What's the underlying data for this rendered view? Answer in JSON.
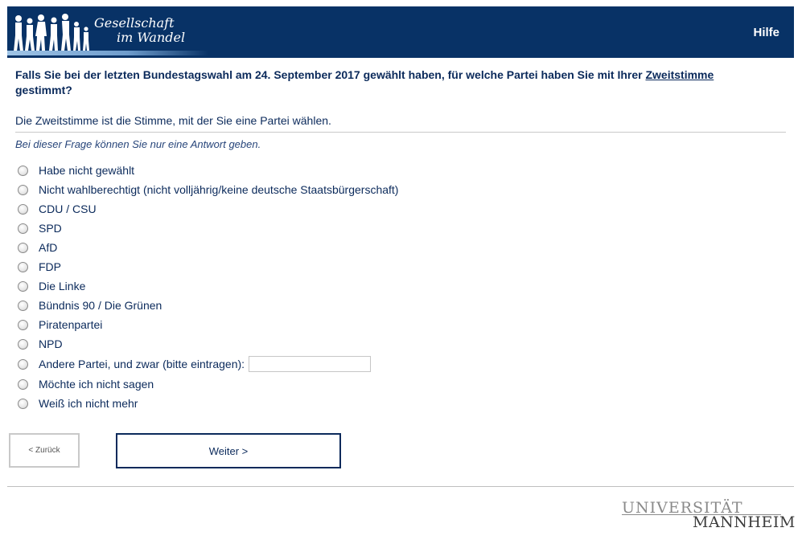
{
  "header": {
    "logo_line1": "Gesellschaft",
    "logo_line2": "im Wandel",
    "help_label": "Hilfe"
  },
  "question": {
    "text_before": "Falls Sie bei der letzten Bundestagswahl am 24. September 2017 gewählt haben, für welche Partei haben Sie mit Ihrer ",
    "keyword": "Zweitstimme",
    "text_after": " gestimmt?",
    "explanation": "Die Zweitstimme ist die Stimme, mit der Sie eine Partei wählen.",
    "instruction": "Bei dieser Frage können Sie nur eine Antwort geben."
  },
  "options": [
    "Habe nicht gewählt",
    "Nicht wahlberechtigt (nicht volljährig/keine deutsche Staatsbürgerschaft)",
    "CDU / CSU",
    "SPD",
    "AfD",
    "FDP",
    "Die Linke",
    "Bündnis 90 / Die Grünen",
    "Piratenpartei",
    "NPD",
    "Andere Partei, und zwar (bitte eintragen):",
    "Möchte ich nicht sagen",
    "Weiß ich nicht mehr"
  ],
  "other_input": {
    "value": "",
    "placeholder": ""
  },
  "nav": {
    "back_label": "< Zurück",
    "next_label": "Weiter >"
  },
  "footer": {
    "university_line1": "UNIVERSITÄT",
    "university_line2": "MANNHEIM"
  },
  "colors": {
    "header_bg": "#083266",
    "text_primary": "#0b2a5b"
  }
}
